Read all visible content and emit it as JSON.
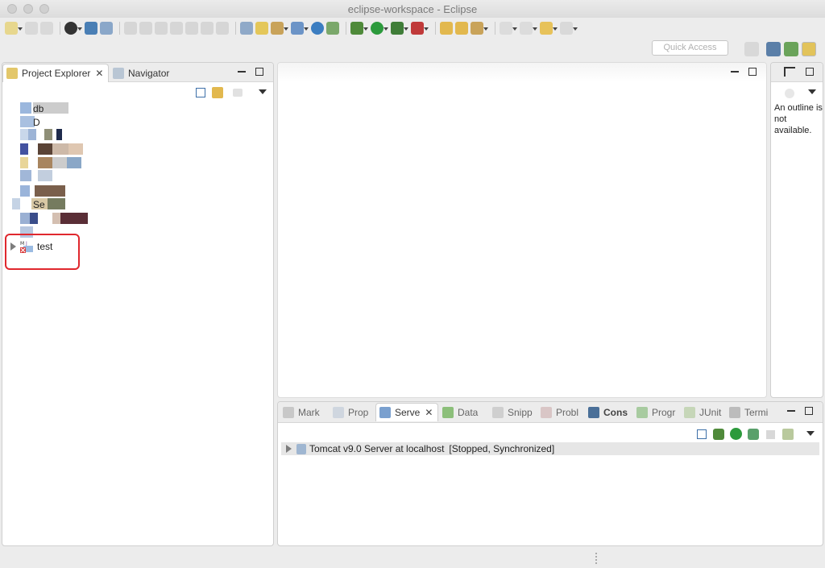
{
  "window": {
    "title": "eclipse-workspace - Eclipse"
  },
  "toolbar": {
    "quick_access_placeholder": "Quick Access"
  },
  "left_panel": {
    "tabs": [
      {
        "label": "Project Explorer",
        "icon": "project-explorer-icon",
        "active": true
      },
      {
        "label": "Navigator",
        "icon": "navigator-icon",
        "active": false
      }
    ],
    "tree_items": [
      {
        "label": "test",
        "icon": "maven-project-error-icon",
        "expanded": false,
        "highlighted": true
      }
    ],
    "blurred_labels": [
      "db",
      "D",
      "Se"
    ]
  },
  "outline_panel": {
    "message": "An outline is not available."
  },
  "bottom_panel": {
    "tabs": [
      {
        "label": "Mark",
        "icon": "markers-icon",
        "active": false
      },
      {
        "label": "Prop",
        "icon": "properties-icon",
        "active": false
      },
      {
        "label": "Serve",
        "icon": "servers-icon",
        "active": true
      },
      {
        "label": "Data",
        "icon": "data-source-icon",
        "active": false
      },
      {
        "label": "Snipp",
        "icon": "snippets-icon",
        "active": false
      },
      {
        "label": "Probl",
        "icon": "problems-icon",
        "active": false
      },
      {
        "label": "Cons",
        "icon": "console-icon",
        "active": false
      },
      {
        "label": "Progr",
        "icon": "progress-icon",
        "active": false
      },
      {
        "label": "JUnit",
        "icon": "junit-icon",
        "active": false
      },
      {
        "label": "Termi",
        "icon": "terminal-icon",
        "active": false
      }
    ],
    "server": {
      "name": "Tomcat v9.0 Server at localhost",
      "state": "[Stopped, Synchronized]"
    }
  },
  "colors": {
    "highlight_box": "#e0282e",
    "selection_row": "#e6e6e6"
  }
}
